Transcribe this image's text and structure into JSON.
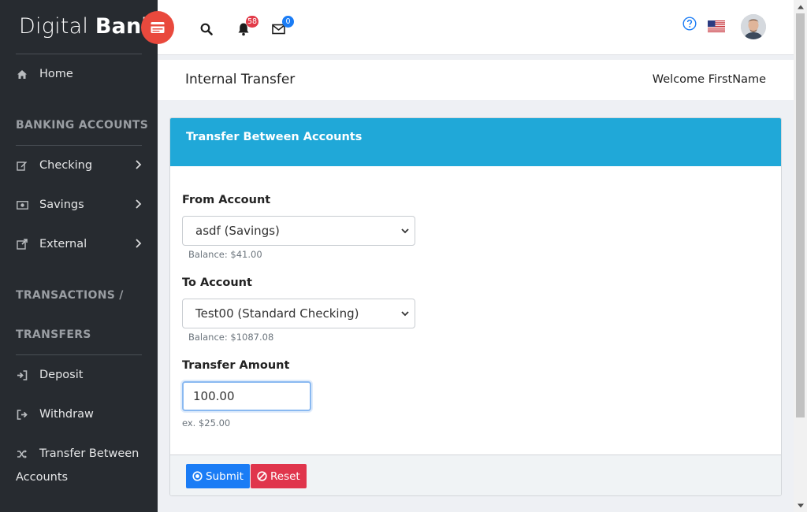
{
  "brand": {
    "light": "Digital",
    "bold": "Bank"
  },
  "header": {
    "notifications_count": "58",
    "messages_count": "0"
  },
  "sidebar": {
    "home": "Home",
    "section_banking": "BANKING ACCOUNTS",
    "checking": "Checking",
    "savings": "Savings",
    "external": "External",
    "section_transactions_line1": "TRANSACTIONS /",
    "section_transactions_line2": "TRANSFERS",
    "deposit": "Deposit",
    "withdraw": "Withdraw",
    "transfer_line1": "Transfer Between",
    "transfer_line2": "Accounts"
  },
  "page": {
    "title": "Internal Transfer",
    "welcome": "Welcome FirstName"
  },
  "form": {
    "card_title": "Transfer Between Accounts",
    "from_label": "From Account",
    "from_value": "asdf (Savings)",
    "from_balance": "Balance: $41.00",
    "to_label": "To Account",
    "to_value": "Test00 (Standard Checking)",
    "to_balance": "Balance: $1087.08",
    "amount_label": "Transfer Amount",
    "amount_value": "100.00",
    "amount_help": "ex. $25.00",
    "submit_label": "Submit",
    "reset_label": "Reset"
  },
  "colors": {
    "sidebar_bg": "#272b30",
    "brand_button": "#e9493d",
    "card_header": "#20a8d8",
    "submit": "#1a7cf5",
    "reset": "#e0354c",
    "notification_badge": "#e23b49",
    "message_badge": "#1a7cf5"
  },
  "icons": {
    "brand_toggle": "credit-card-icon",
    "search": "search-icon",
    "notifications": "bell-icon",
    "messages": "envelope-icon",
    "help": "question-circle-icon",
    "language": "us-flag-icon",
    "home": "home-icon",
    "checking": "edit-icon",
    "savings": "money-icon",
    "external": "external-link-icon",
    "deposit": "sign-in-icon",
    "withdraw": "sign-out-icon",
    "transfer": "random-icon",
    "submit": "dot-circle-icon",
    "reset": "ban-icon"
  }
}
